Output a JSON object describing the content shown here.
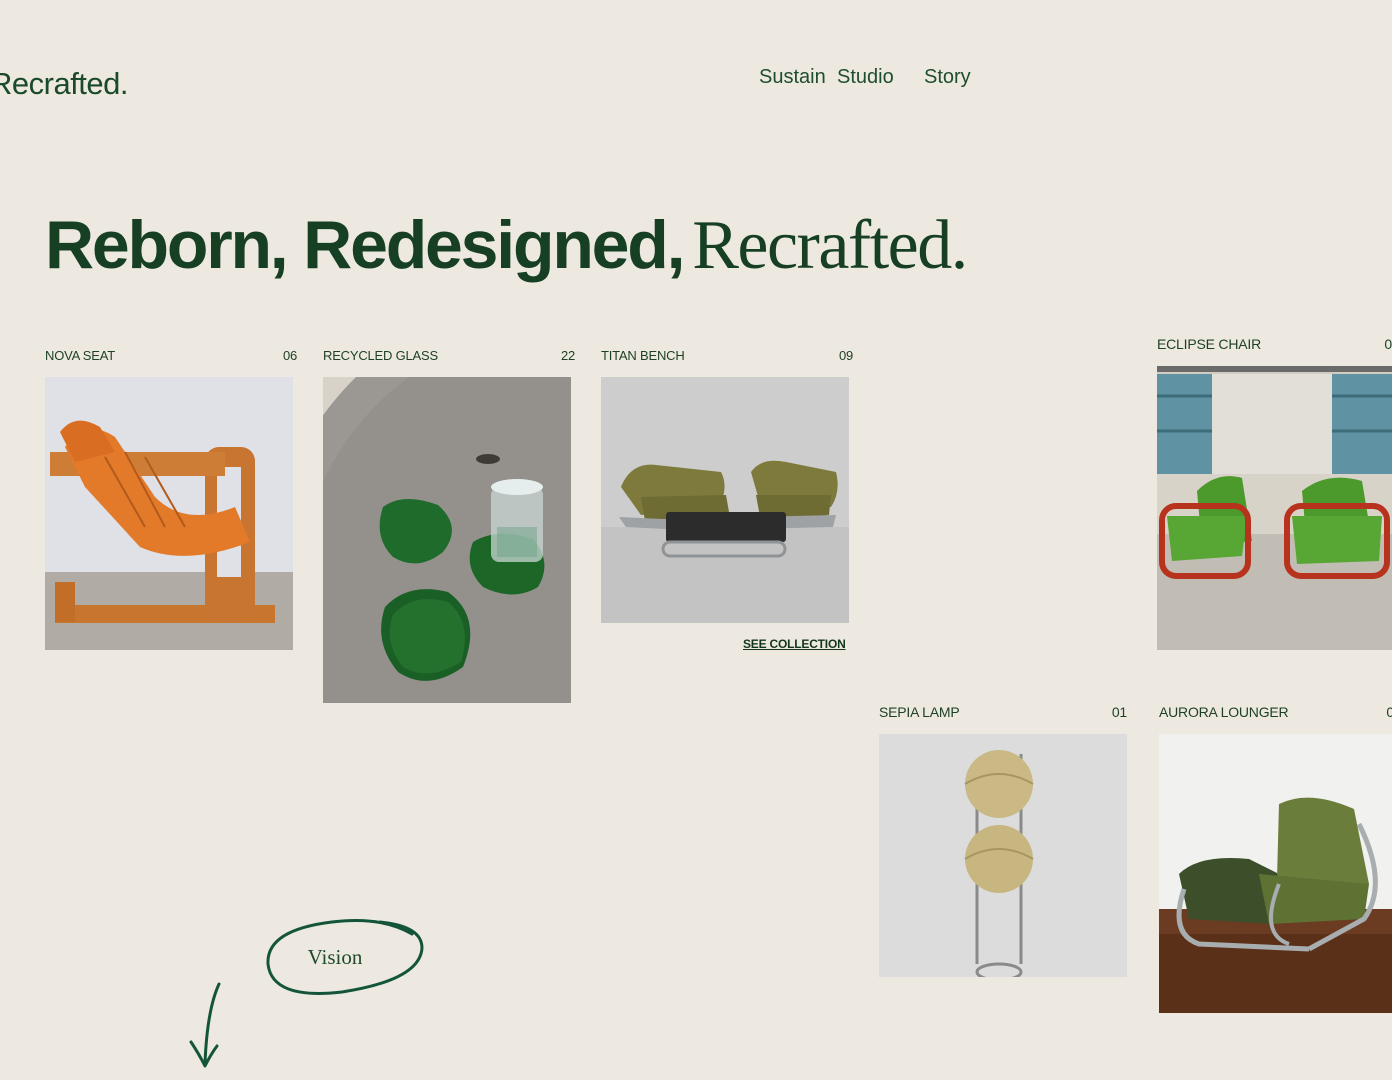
{
  "brand": {
    "logo": "Recrafted."
  },
  "nav": {
    "items": [
      "Sustain",
      "Studio",
      "Story"
    ]
  },
  "hero": {
    "bold": "Reborn, Redesigned,",
    "serif": "Recrafted."
  },
  "products": [
    {
      "name": "NOVA SEAT",
      "count": "06"
    },
    {
      "name": "RECYCLED GLASS",
      "count": "22"
    },
    {
      "name": "TITAN BENCH",
      "count": "09"
    },
    {
      "name": "ECLIPSE CHAIR",
      "count": "0"
    },
    {
      "name": "SEPIA LAMP",
      "count": "01"
    },
    {
      "name": "AURORA LOUNGER",
      "count": "0"
    }
  ],
  "collection_link": "SEE COLLECTION",
  "vision_label": "Vision",
  "icons": {
    "arrow": "arrow-down-icon"
  }
}
